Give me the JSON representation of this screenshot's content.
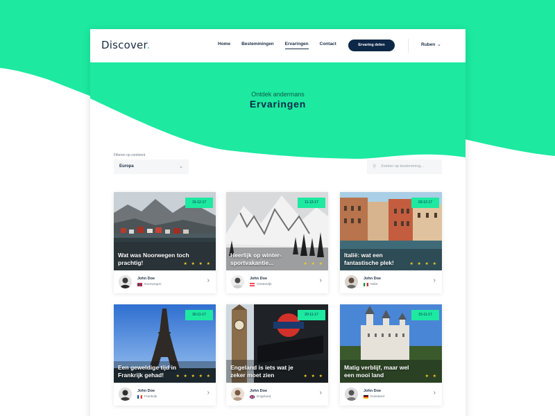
{
  "brand": {
    "logo_text": "Discover",
    "logo_dot": ".",
    "accent": "#1de9a0",
    "navy": "#0d2746"
  },
  "nav": {
    "items": [
      {
        "label": "Home",
        "active": false
      },
      {
        "label": "Bestemmingen",
        "active": false
      },
      {
        "label": "Ervaringen",
        "active": true
      },
      {
        "label": "Contact",
        "active": false
      }
    ],
    "cta_label": "Ervaring delen",
    "user_name": "Ruben"
  },
  "hero": {
    "subtitle": "Ontdek andermans",
    "title": "Ervaringen"
  },
  "filter": {
    "label": "Filteren op continent",
    "value": "Europa",
    "search_placeholder": "Zoeken op bestemming..."
  },
  "cards": [
    {
      "date": "15-12-17",
      "title": "Wat was Noorwegen toch prachtig!",
      "stars": "★ ★ ★ ★",
      "author": "John Doe",
      "country": "Noorwegen",
      "flag": "norway"
    },
    {
      "date": "11-12-17",
      "title": "Heerlijk op winter-sportvakantie...",
      "stars": "★ ★ ★",
      "author": "John Doe",
      "country": "Oostenrijk",
      "flag": "austria"
    },
    {
      "date": "03-12-17",
      "title": "Italië: wat een fantastische plek!",
      "stars": "★ ★ ★ ★",
      "author": "John Doe",
      "country": "Italië",
      "flag": "italy"
    },
    {
      "date": "30-11-17",
      "title": "Een geweldige tijd in Frankrijk gehad!",
      "stars": "★ ★ ★ ★ ★",
      "author": "John Doe",
      "country": "Frankrijk",
      "flag": "france"
    },
    {
      "date": "20-11-17",
      "title": "Engeland is iets wat je zeker moet zien",
      "stars": "★ ★ ★",
      "author": "John Doe",
      "country": "Engeland",
      "flag": "uk"
    },
    {
      "date": "15-11-17",
      "title": "Matig verblijf, maar wel een mooi land",
      "stars": "★ ★",
      "author": "John Doe",
      "country": "Duitsland",
      "flag": "germany"
    }
  ]
}
